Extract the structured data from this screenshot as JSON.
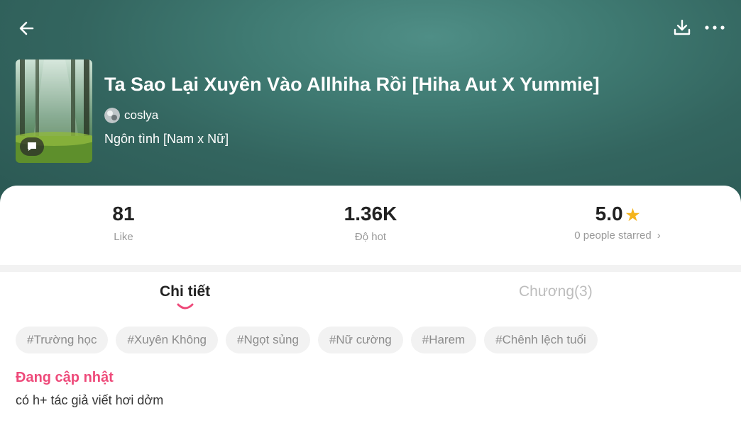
{
  "header": {
    "title": "Ta Sao Lại Xuyên Vào Allhiha Rồi [Hiha Aut X Yummie]",
    "author": "coslya",
    "genre": "Ngôn tình [Nam x Nữ]",
    "icons": [
      "back-arrow-icon",
      "download-icon",
      "more-icon"
    ]
  },
  "stats": {
    "likes": {
      "value": "81",
      "label": "Like"
    },
    "hot": {
      "value": "1.36K",
      "label": "Độ hot"
    },
    "rating": {
      "value": "5.0",
      "label": "0 people starred"
    }
  },
  "tabs": [
    {
      "label": "Chi tiết",
      "active": true
    },
    {
      "label": "Chương(3)",
      "active": false
    }
  ],
  "tags": [
    "#Trường học",
    "#Xuyên Không",
    "#Ngọt sủng",
    "#Nữ cường",
    "#Harem",
    "#Chênh lệch tuổi"
  ],
  "status": "Đang cập nhật",
  "description": "có h+ tác giả viết hơi dởm",
  "colors": {
    "accent": "#ee4a7a",
    "star": "#f5b41c",
    "header": "#3f7a72"
  }
}
